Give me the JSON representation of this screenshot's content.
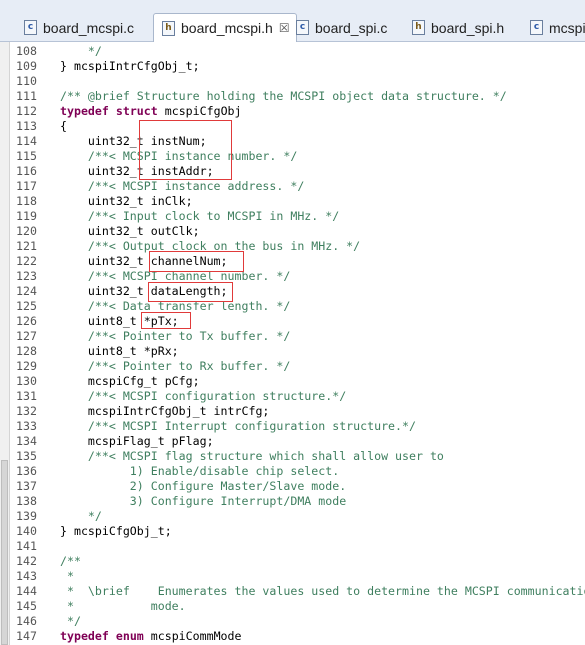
{
  "tabs": [
    {
      "label": "board_mcspi.c",
      "icon": "c-file-icon",
      "active": false
    },
    {
      "label": "board_mcspi.h",
      "icon": "h-file-icon",
      "active": true,
      "close": "☒"
    },
    {
      "label": "board_spi.c",
      "icon": "c-file-icon",
      "active": false
    },
    {
      "label": "board_spi.h",
      "icon": "h-file-icon",
      "active": false
    },
    {
      "label": "mcspi",
      "icon": "c-file-icon",
      "active": false
    }
  ],
  "code_lines": [
    {
      "n": "108",
      "t": "    */"
    },
    {
      "n": "109",
      "t": "} mcspiIntrCfgObj_t;"
    },
    {
      "n": "110",
      "t": ""
    },
    {
      "n": "111",
      "t": "/** @brief Structure holding the MCSPI object data structure. */"
    },
    {
      "n": "112",
      "t": "typedef struct mcspiCfgObj"
    },
    {
      "n": "113",
      "t": "{"
    },
    {
      "n": "114",
      "t": "    uint32_t instNum;"
    },
    {
      "n": "115",
      "t": "    /**< MCSPI instance number. */"
    },
    {
      "n": "116",
      "t": "    uint32_t instAddr;"
    },
    {
      "n": "117",
      "t": "    /**< MCSPI instance address. */"
    },
    {
      "n": "118",
      "t": "    uint32_t inClk;"
    },
    {
      "n": "119",
      "t": "    /**< Input clock to MCSPI in MHz. */"
    },
    {
      "n": "120",
      "t": "    uint32_t outClk;"
    },
    {
      "n": "121",
      "t": "    /**< Output clock on the bus in MHz. */"
    },
    {
      "n": "122",
      "t": "    uint32_t channelNum;"
    },
    {
      "n": "123",
      "t": "    /**< MCSPI channel number. */"
    },
    {
      "n": "124",
      "t": "    uint32_t dataLength;"
    },
    {
      "n": "125",
      "t": "    /**< Data transfer length. */"
    },
    {
      "n": "126",
      "t": "    uint8_t *pTx;"
    },
    {
      "n": "127",
      "t": "    /**< Pointer to Tx buffer. */"
    },
    {
      "n": "128",
      "t": "    uint8_t *pRx;"
    },
    {
      "n": "129",
      "t": "    /**< Pointer to Rx buffer. */"
    },
    {
      "n": "130",
      "t": "    mcspiCfg_t pCfg;"
    },
    {
      "n": "131",
      "t": "    /**< MCSPI configuration structure.*/"
    },
    {
      "n": "132",
      "t": "    mcspiIntrCfgObj_t intrCfg;"
    },
    {
      "n": "133",
      "t": "    /**< MCSPI Interrupt configuration structure.*/"
    },
    {
      "n": "134",
      "t": "    mcspiFlag_t pFlag;"
    },
    {
      "n": "135",
      "t": "    /**< MCSPI flag structure which shall allow user to"
    },
    {
      "n": "136",
      "t": "          1) Enable/disable chip select."
    },
    {
      "n": "137",
      "t": "          2) Configure Master/Slave mode."
    },
    {
      "n": "138",
      "t": "          3) Configure Interrupt/DMA mode"
    },
    {
      "n": "139",
      "t": "    */"
    },
    {
      "n": "140",
      "t": "} mcspiCfgObj_t;"
    },
    {
      "n": "141",
      "t": ""
    },
    {
      "n": "142",
      "t": "/**"
    },
    {
      "n": "143",
      "t": " *"
    },
    {
      "n": "144",
      "t": " *  \\brief    Enumerates the values used to determine the MCSPI communication"
    },
    {
      "n": "145",
      "t": " *           mode."
    },
    {
      "n": "146",
      "t": " */"
    },
    {
      "n": "147",
      "t": "typedef enum mcspiCommMode"
    }
  ],
  "colors": {
    "comment": "#3f7f5f",
    "keyword": "#7f0055",
    "highlight_box": "#e03a3a"
  }
}
